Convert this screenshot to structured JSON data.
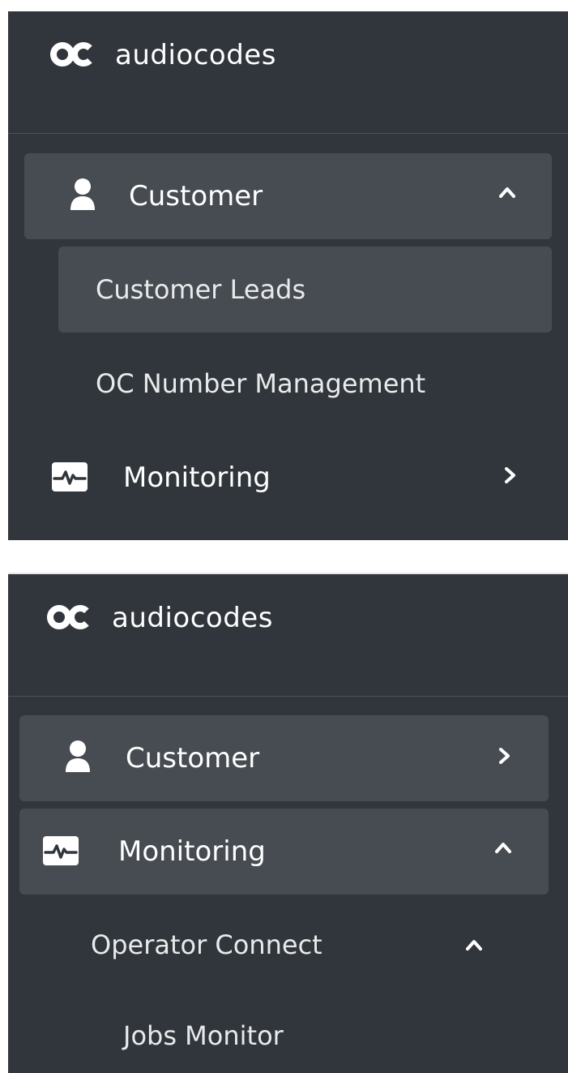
{
  "panel_top": {
    "brand": {
      "name": "audiocodes"
    },
    "menu": {
      "customer": {
        "label": "Customer",
        "icon": "user-icon",
        "expanded": true
      },
      "submenu": [
        {
          "label": "Customer Leads",
          "active": true
        },
        {
          "label": "OC Number Management",
          "active": false
        }
      ],
      "monitoring": {
        "label": "Monitoring",
        "icon": "heartbeat-monitor-icon",
        "expanded": false
      }
    }
  },
  "panel_bottom": {
    "brand": {
      "name": "audiocodes"
    },
    "menu": {
      "customer": {
        "label": "Customer",
        "icon": "user-icon",
        "expanded": false
      },
      "monitoring": {
        "label": "Monitoring",
        "icon": "heartbeat-monitor-icon",
        "expanded": true
      },
      "operator_connect": {
        "label": "Operator Connect",
        "expanded": true
      },
      "jobs_monitor": {
        "label": "Jobs Monitor"
      }
    }
  },
  "colors": {
    "sidebar_bg": "#31363c",
    "active_bg": "#464c52",
    "text": "#ffffff"
  }
}
